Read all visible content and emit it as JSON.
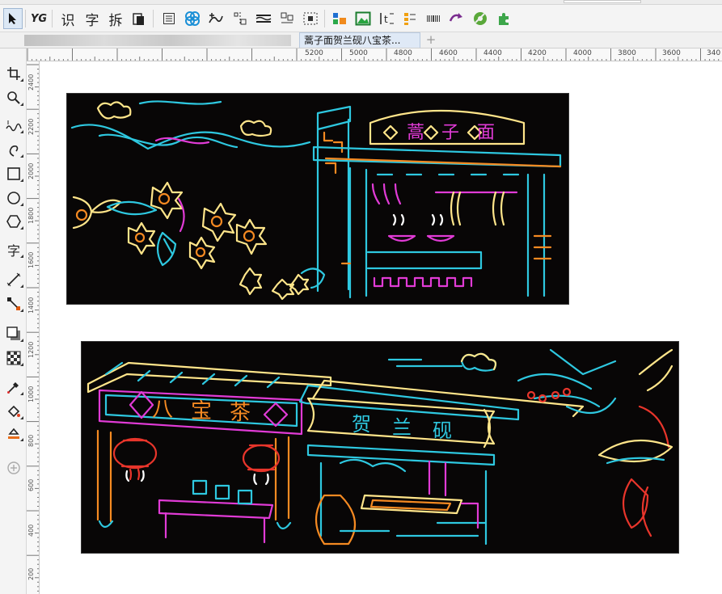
{
  "document_tab": {
    "title": "蒿子面贺兰砚八宝茶..."
  },
  "toolbar": {
    "items": [
      {
        "name": "pick-tool-icon",
        "glyph": ""
      },
      {
        "name": "yg-plugin-button",
        "glyph": "YG"
      },
      {
        "name": "identify-button",
        "glyph": "识"
      },
      {
        "name": "text-button",
        "glyph": "字"
      },
      {
        "name": "split-button",
        "glyph": "拆"
      }
    ]
  },
  "sign_left": {
    "chars": [
      "蒿",
      "子",
      "面"
    ]
  },
  "sign_bottom_left": {
    "chars": [
      "八",
      "宝",
      "茶"
    ]
  },
  "sign_bottom_right": {
    "chars": [
      "贺",
      "兰",
      "砚"
    ]
  },
  "hruler": {
    "labels": [
      "5200",
      "5000",
      "4800",
      "4600",
      "4400",
      "4200",
      "4000",
      "3800",
      "3600",
      "340"
    ]
  },
  "vruler": {
    "labels": [
      "2400",
      "2200",
      "2000",
      "1800",
      "1600",
      "1400",
      "1200",
      "1000",
      "800",
      "600",
      "400",
      "200"
    ]
  },
  "lefttoolbar": {
    "text_tool_glyph": "字"
  },
  "colors": {
    "neon_cyan": "#2ec8e0",
    "neon_yellow": "#ffe58a",
    "neon_magenta": "#e13bd6",
    "neon_orange": "#f58a22",
    "neon_red": "#e8352b",
    "artboard_bg": "#080606"
  }
}
